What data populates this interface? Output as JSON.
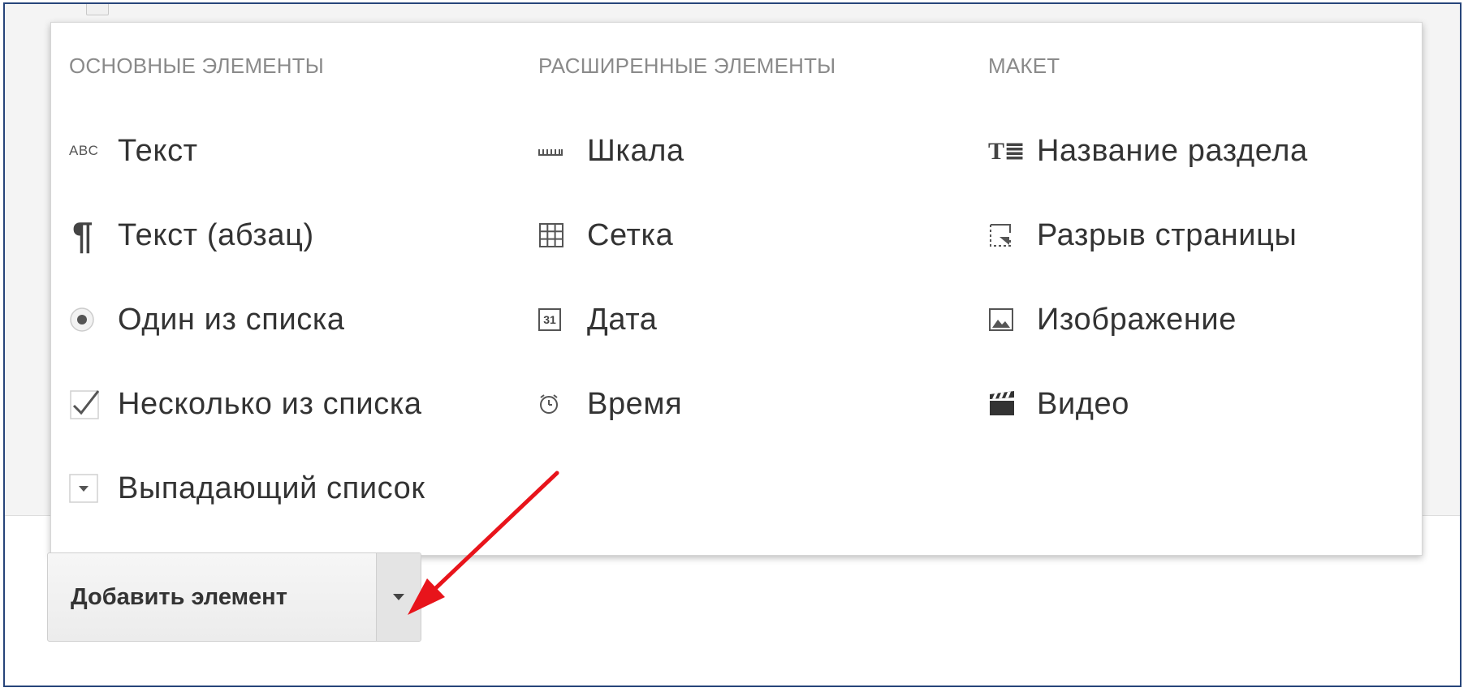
{
  "menu": {
    "basic": {
      "header": "ОСНОВНЫЕ ЭЛЕМЕНТЫ",
      "items": [
        {
          "label": "Текст",
          "icon": "abc-text-icon",
          "icon_text": "ABC"
        },
        {
          "label": "Текст (абзац)",
          "icon": "paragraph-icon",
          "icon_text": "¶"
        },
        {
          "label": "Один из списка",
          "icon": "radio-button-icon"
        },
        {
          "label": "Несколько из списка",
          "icon": "checkbox-icon"
        },
        {
          "label": "Выпадающий список",
          "icon": "dropdown-icon"
        }
      ]
    },
    "advanced": {
      "header": "РАСШИРЕННЫЕ ЭЛЕМЕНТЫ",
      "items": [
        {
          "label": "Шкала",
          "icon": "scale-icon"
        },
        {
          "label": "Сетка",
          "icon": "grid-icon"
        },
        {
          "label": "Дата",
          "icon": "calendar-icon",
          "icon_text": "31"
        },
        {
          "label": "Время",
          "icon": "clock-icon"
        }
      ]
    },
    "layout": {
      "header": "МАКЕТ",
      "items": [
        {
          "label": "Название раздела",
          "icon": "section-title-icon",
          "icon_text": "T≣"
        },
        {
          "label": "Разрыв страницы",
          "icon": "page-break-icon"
        },
        {
          "label": "Изображение",
          "icon": "image-icon"
        },
        {
          "label": "Видео",
          "icon": "video-icon"
        }
      ]
    }
  },
  "add_button": {
    "label": "Добавить элемент",
    "toggle_icon": "chevron-down-icon"
  },
  "annotation": {
    "icon": "red-arrow-icon",
    "color": "#e8141b"
  },
  "colors": {
    "frame_border": "#27457a",
    "header_text": "#8a8a8a",
    "item_text": "#333333"
  }
}
